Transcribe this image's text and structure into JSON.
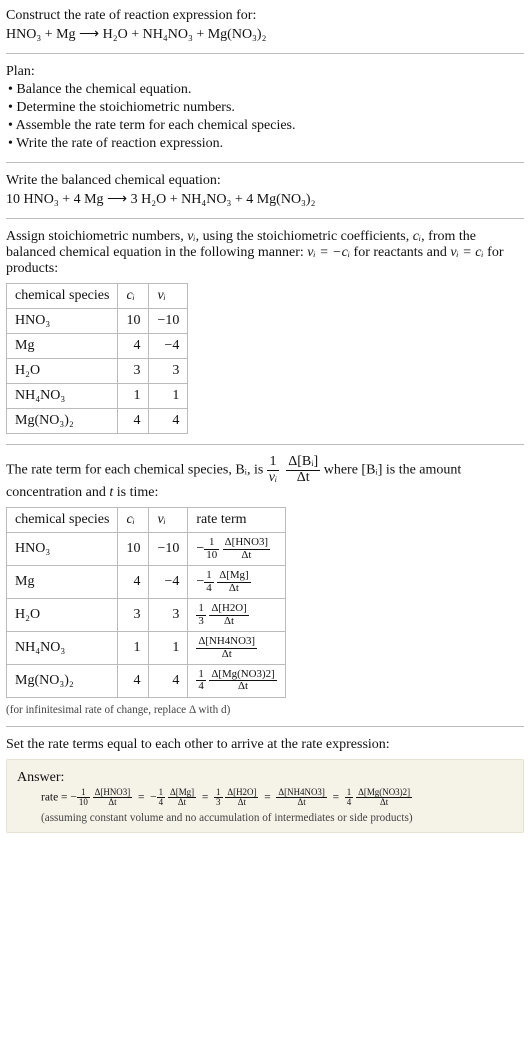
{
  "prompt": {
    "line1": "Construct the rate of reaction expression for:",
    "equation": "HNO₃ + Mg ⟶ H₂O + NH₄NO₃ + Mg(NO₃)₂"
  },
  "plan": {
    "heading": "Plan:",
    "items": [
      "• Balance the chemical equation.",
      "• Determine the stoichiometric numbers.",
      "• Assemble the rate term for each chemical species.",
      "• Write the rate of reaction expression."
    ]
  },
  "balanced": {
    "heading": "Write the balanced chemical equation:",
    "equation": "10 HNO₃ + 4 Mg ⟶ 3 H₂O + NH₄NO₃ + 4 Mg(NO₃)₂"
  },
  "stoich": {
    "intro_before_nu": "Assign stoichiometric numbers, ",
    "nu_i": "νᵢ",
    "intro_mid1": ", using the stoichiometric coefficients, ",
    "c_i": "cᵢ",
    "intro_mid2": ", from the balanced chemical equation in the following manner: ",
    "rel1": "νᵢ = −cᵢ",
    "intro_mid3": " for reactants and ",
    "rel2": "νᵢ = cᵢ",
    "intro_end": " for products:",
    "table": {
      "headers": [
        "chemical species",
        "cᵢ",
        "νᵢ"
      ],
      "rows": [
        [
          "HNO₃",
          "10",
          "−10"
        ],
        [
          "Mg",
          "4",
          "−4"
        ],
        [
          "H₂O",
          "3",
          "3"
        ],
        [
          "NH₄NO₃",
          "1",
          "1"
        ],
        [
          "Mg(NO₃)₂",
          "4",
          "4"
        ]
      ]
    }
  },
  "rate_term": {
    "intro_before": "The rate term for each chemical species, Bᵢ, is ",
    "frac1_num": "1",
    "frac1_den": "νᵢ",
    "frac2_num": "Δ[Bᵢ]",
    "frac2_den": "Δt",
    "intro_after": " where [Bᵢ] is the amount concentration and ",
    "t_var": "t",
    "intro_end": " is time:",
    "table": {
      "headers": [
        "chemical species",
        "cᵢ",
        "νᵢ",
        "rate term"
      ],
      "rows": [
        {
          "species": "HNO₃",
          "ci": "10",
          "nui": "−10",
          "neg": "−",
          "pre_num": "1",
          "pre_den": "10",
          "d_num": "Δ[HNO3]",
          "d_den": "Δt"
        },
        {
          "species": "Mg",
          "ci": "4",
          "nui": "−4",
          "neg": "−",
          "pre_num": "1",
          "pre_den": "4",
          "d_num": "Δ[Mg]",
          "d_den": "Δt"
        },
        {
          "species": "H₂O",
          "ci": "3",
          "nui": "3",
          "neg": "",
          "pre_num": "1",
          "pre_den": "3",
          "d_num": "Δ[H2O]",
          "d_den": "Δt"
        },
        {
          "species": "NH₄NO₃",
          "ci": "1",
          "nui": "1",
          "neg": "",
          "pre_num": "",
          "pre_den": "",
          "d_num": "Δ[NH4NO3]",
          "d_den": "Δt"
        },
        {
          "species": "Mg(NO₃)₂",
          "ci": "4",
          "nui": "4",
          "neg": "",
          "pre_num": "1",
          "pre_den": "4",
          "d_num": "Δ[Mg(NO3)2]",
          "d_den": "Δt"
        }
      ]
    },
    "footnote": "(for infinitesimal rate of change, replace Δ with d)"
  },
  "final": {
    "heading": "Set the rate terms equal to each other to arrive at the rate expression:",
    "answer_label": "Answer:",
    "rate_label": "rate = ",
    "terms": [
      {
        "neg": "−",
        "pre_num": "1",
        "pre_den": "10",
        "d_num": "Δ[HNO3]",
        "d_den": "Δt"
      },
      {
        "neg": "−",
        "pre_num": "1",
        "pre_den": "4",
        "d_num": "Δ[Mg]",
        "d_den": "Δt"
      },
      {
        "neg": "",
        "pre_num": "1",
        "pre_den": "3",
        "d_num": "Δ[H2O]",
        "d_den": "Δt"
      },
      {
        "neg": "",
        "pre_num": "",
        "pre_den": "",
        "d_num": "Δ[NH4NO3]",
        "d_den": "Δt"
      },
      {
        "neg": "",
        "pre_num": "1",
        "pre_den": "4",
        "d_num": "Δ[Mg(NO3)2]",
        "d_den": "Δt"
      }
    ],
    "assumption": "(assuming constant volume and no accumulation of intermediates or side products)"
  }
}
